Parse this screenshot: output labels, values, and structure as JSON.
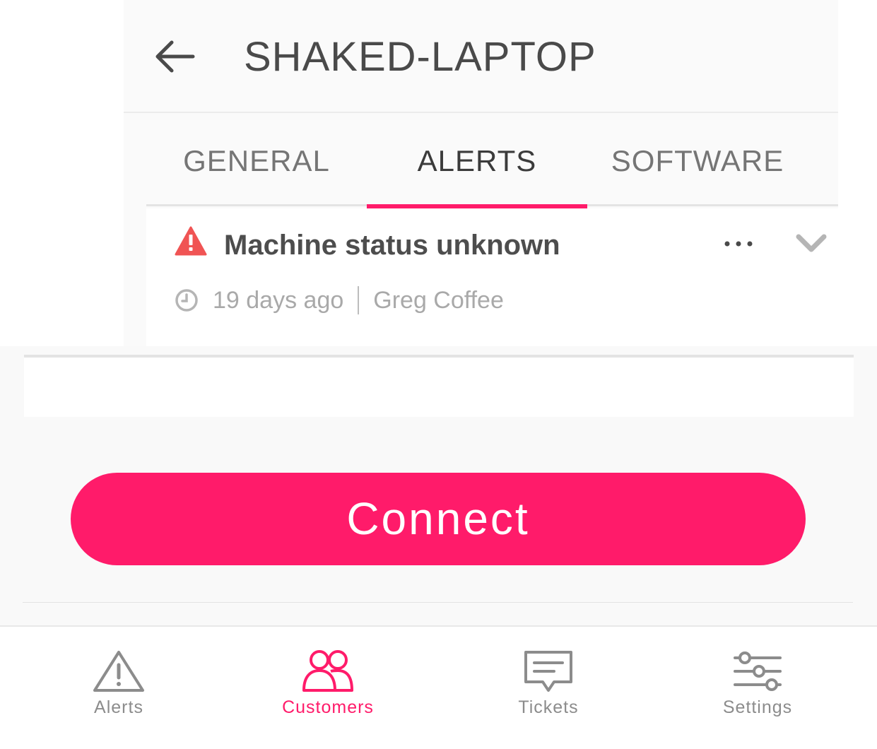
{
  "header": {
    "title": "SHAKED-LAPTOP",
    "back_icon": "arrow-left-icon"
  },
  "tabs": [
    {
      "label": "GENERAL",
      "active": false
    },
    {
      "label": "ALERTS",
      "active": true
    },
    {
      "label": "SOFTWARE",
      "active": false
    }
  ],
  "alert": {
    "icon": "warning-icon",
    "title": "Machine status unknown",
    "time_ago": "19 days ago",
    "user": "Greg Coffee",
    "more_icon": "more-dots-icon",
    "expand_icon": "chevron-down-icon"
  },
  "actions": {
    "connect_label": "Connect"
  },
  "bottom_nav": [
    {
      "label": "Alerts",
      "icon": "alert-triangle-icon",
      "active": false
    },
    {
      "label": "Customers",
      "icon": "users-icon",
      "active": true
    },
    {
      "label": "Tickets",
      "icon": "message-icon",
      "active": false
    },
    {
      "label": "Settings",
      "icon": "sliders-icon",
      "active": false
    }
  ],
  "colors": {
    "accent": "#ff1b6a",
    "warning": "#f05454",
    "text_primary": "#4a4a4a",
    "text_muted": "#a9a9a9",
    "nav_inactive": "#8c8c8c"
  }
}
